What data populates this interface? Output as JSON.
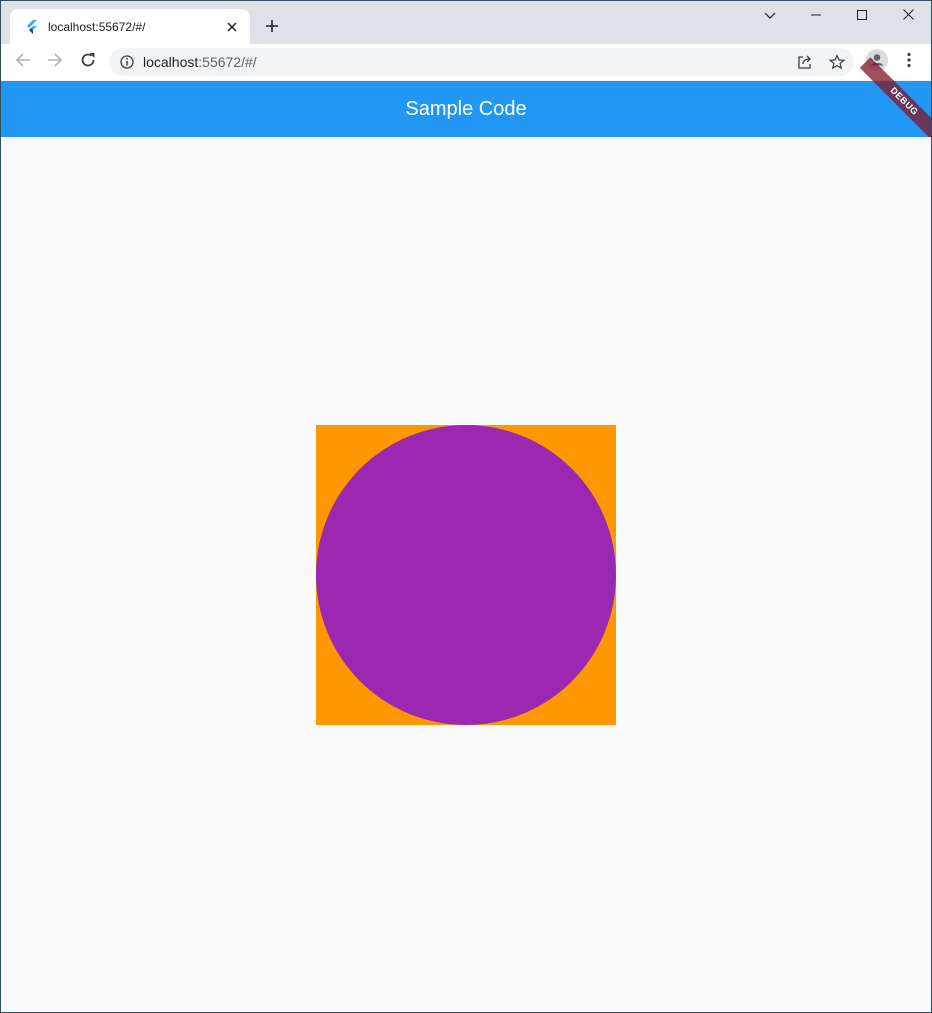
{
  "browser": {
    "tab": {
      "title": "localhost:55672/#/",
      "favicon": "flutter-icon"
    },
    "new_tab_icon": "plus-icon",
    "window_controls": [
      "chevron-down-icon",
      "minimize-icon",
      "maximize-icon",
      "close-icon"
    ],
    "toolbar": {
      "back_icon": "back-arrow-icon",
      "forward_icon": "forward-arrow-icon",
      "reload_icon": "reload-icon",
      "info_icon": "info-icon",
      "url_host": "localhost",
      "url_rest": ":55672/#/",
      "share_icon": "share-icon",
      "star_icon": "star-icon",
      "profile_icon": "profile-icon",
      "menu_icon": "more-vert-icon"
    }
  },
  "app": {
    "title": "Sample Code",
    "debug_banner": "DEBUG",
    "colors": {
      "app_bar": "#2196f3",
      "square": "#ff9800",
      "circle": "#9c27b0",
      "background": "#fafafa"
    }
  }
}
